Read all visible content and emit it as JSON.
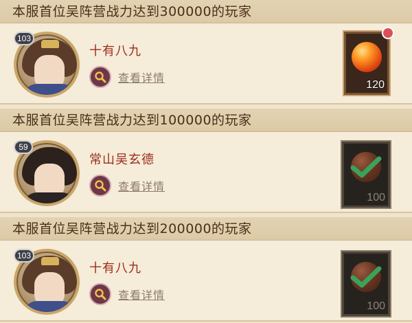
{
  "entries": [
    {
      "title": "本服首位吴阵营战力达到300000的玩家",
      "level": "103",
      "player_name": "十有八九",
      "detail_label": "查看详情",
      "reward": {
        "count": "120",
        "claimed": false,
        "has_notification": true
      }
    },
    {
      "title": "本服首位吴阵营战力达到100000的玩家",
      "level": "59",
      "player_name": "常山吴玄德",
      "detail_label": "查看详情",
      "reward": {
        "count": "100",
        "claimed": true,
        "has_notification": false
      }
    },
    {
      "title": "本服首位吴阵营战力达到200000的玩家",
      "level": "103",
      "player_name": "十有八九",
      "detail_label": "查看详情",
      "reward": {
        "count": "100",
        "claimed": true,
        "has_notification": false
      }
    }
  ],
  "icons": {
    "detail": "magnifier-icon",
    "reward": "fire-orb-icon",
    "claimed": "checkmark-icon",
    "notify": "red-dot-icon"
  },
  "colors": {
    "background": "#efe4cc",
    "title_text": "#4a2e1a",
    "player_name": "#9c2c1a",
    "detail_button": "#6c3848",
    "claimed_check": "#3aa35a",
    "notification": "#d9505a"
  }
}
